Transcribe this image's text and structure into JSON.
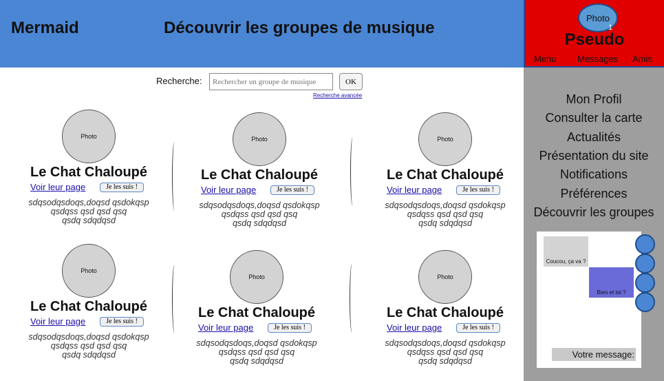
{
  "header": {
    "brand": "Mermaid",
    "title": "Découvrir les groupes de musique"
  },
  "user_panel": {
    "avatar_label": "Photo",
    "notification_count": "1",
    "username": "Pseudo",
    "nav": [
      "Menu",
      "Messages",
      "Amis"
    ]
  },
  "search": {
    "label": "Recherche:",
    "placeholder": "Rechercher un groupe de musique",
    "button": "OK",
    "advanced_link": "Recherche avancée"
  },
  "groups": [
    {
      "photo": "Photo",
      "name": "Le Chat Chaloupé",
      "page_link": "Voir leur page",
      "follow": "Je les suis !",
      "desc": [
        "sdqsodqsdoqs,doqsd qsdokqsp",
        "qsdqss qsd qsd qsq",
        "qsdq sdqdqsd"
      ]
    },
    {
      "photo": "Photo",
      "name": "Le Chat Chaloupé",
      "page_link": "Voir leur page",
      "follow": "Je les suis !",
      "desc": [
        "sdqsodqsdoqs,doqsd qsdokqsp",
        "qsdqss qsd qsd qsq",
        "qsdq sdqdqsd"
      ]
    },
    {
      "photo": "Photo",
      "name": "Le Chat Chaloupé",
      "page_link": "Voir leur page",
      "follow": "Je les suis !",
      "desc": [
        "sdqsodqsdoqs,doqsd qsdokqsp",
        "qsdqss qsd qsd qsq",
        "qsdq sdqdqsd"
      ]
    },
    {
      "photo": "Photo",
      "name": "Le Chat Chaloupé",
      "page_link": "Voir leur page",
      "follow": "Je les suis !",
      "desc": [
        "sdqsodqsdoqs,doqsd qsdokqsp",
        "qsdqss qsd qsd qsq",
        "qsdq sdqdqsd"
      ]
    },
    {
      "photo": "Photo",
      "name": "Le Chat Chaloupé",
      "page_link": "Voir leur page",
      "follow": "Je les suis !",
      "desc": [
        "sdqsodqsdoqs,doqsd qsdokqsp",
        "qsdqss qsd qsd qsq",
        "qsdq sdqdqsd"
      ]
    },
    {
      "photo": "Photo",
      "name": "Le Chat Chaloupé",
      "page_link": "Voir leur page",
      "follow": "Je les suis !",
      "desc": [
        "sdqsodqsdoqs,doqsd qsdokqsp",
        "qsdqss qsd qsd qsq",
        "qsdq sdqdqsd"
      ]
    }
  ],
  "sidebar": {
    "links": [
      "Mon Profil",
      "Consulter la carte",
      "Actualités",
      "Présentation du site",
      "Notifications",
      "Préférences",
      "Découvrir les groupes"
    ]
  },
  "chat": {
    "incoming": "Coucou, ça va ?",
    "outgoing": "Bien et toi ?",
    "input_label": "Votre message:",
    "friend_icons": [
      "friend-avatar-icon",
      "friend-avatar-icon",
      "friend-avatar-icon",
      "friend-avatar-icon"
    ]
  },
  "colors": {
    "header": "#4a86d4",
    "user_panel": "#e00000",
    "sidebar": "#9e9e9e",
    "outgoing_bubble": "#6a6ad8"
  }
}
